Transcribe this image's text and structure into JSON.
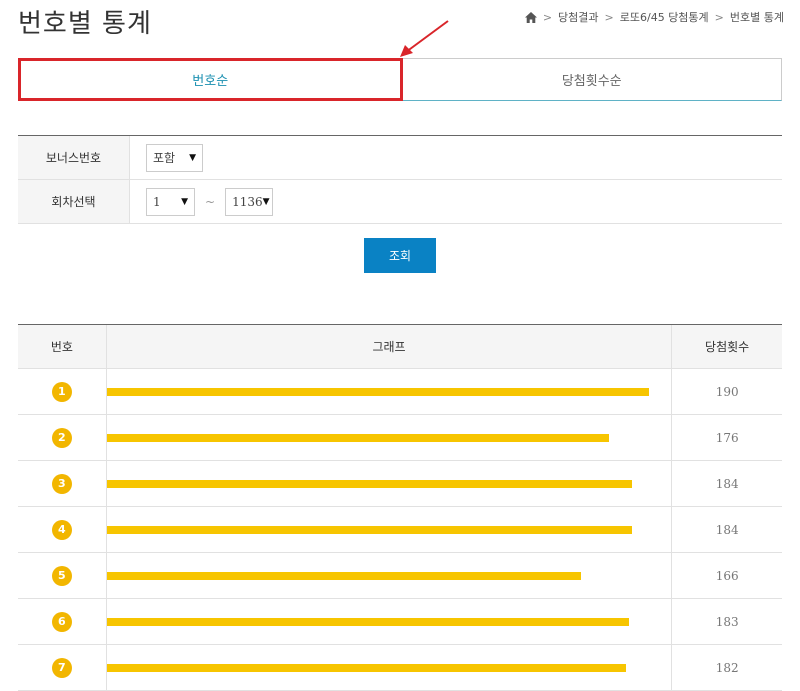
{
  "page": {
    "title": "번호별 통계"
  },
  "breadcrumb": {
    "items": [
      "당첨결과",
      "로또6/45 당첨통계",
      "번호별 통계"
    ],
    "separator": ">"
  },
  "tabs": [
    {
      "label": "번호순",
      "active": true
    },
    {
      "label": "당첨횟수순",
      "active": false
    }
  ],
  "filters": {
    "bonus": {
      "label": "보너스번호",
      "value": "포함"
    },
    "round": {
      "label": "회차선택",
      "from": "1",
      "to": "1136",
      "separator": "~"
    }
  },
  "search_button": {
    "label": "조회"
  },
  "table": {
    "headers": {
      "number": "번호",
      "graph": "그래프",
      "count": "당첨횟수"
    },
    "bar_color": "#f7c500",
    "ball_color": "#f2b600",
    "max_count": 190,
    "rows": [
      {
        "number": "1",
        "count": "190",
        "value": 190
      },
      {
        "number": "2",
        "count": "176",
        "value": 176
      },
      {
        "number": "3",
        "count": "184",
        "value": 184
      },
      {
        "number": "4",
        "count": "184",
        "value": 184
      },
      {
        "number": "5",
        "count": "166",
        "value": 166
      },
      {
        "number": "6",
        "count": "183",
        "value": 183
      },
      {
        "number": "7",
        "count": "182",
        "value": 182
      }
    ]
  },
  "colors": {
    "accent": "#0a82c4",
    "tab_active_text": "#1a8fb0",
    "highlight": "#d9252a"
  }
}
